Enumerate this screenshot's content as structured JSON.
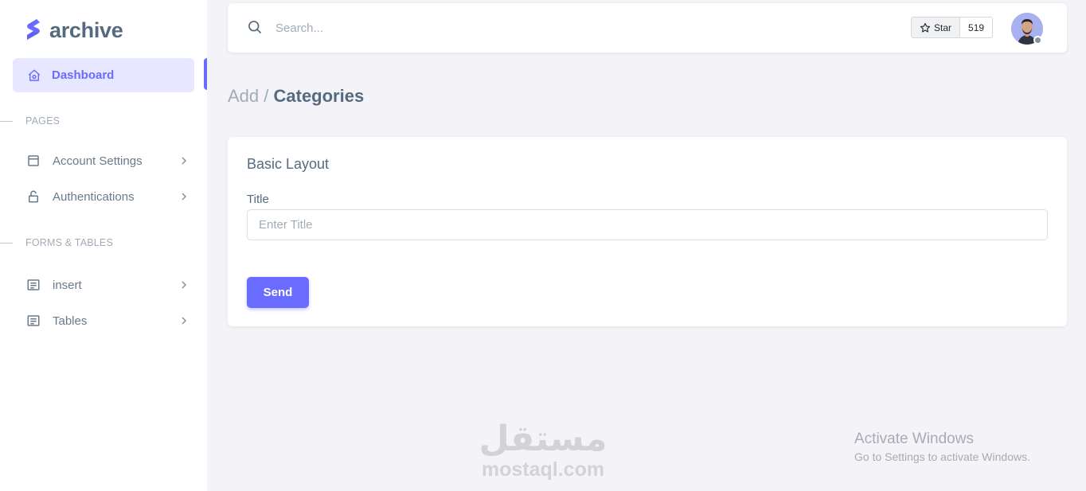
{
  "brand": {
    "name": "archive",
    "color": "#696cff"
  },
  "sidebar": {
    "active_item": {
      "label": "Dashboard",
      "icon": "home-icon"
    },
    "sections": [
      {
        "title": "PAGES",
        "items": [
          {
            "label": "Account Settings",
            "icon": "layout-icon"
          },
          {
            "label": "Authentications",
            "icon": "lock-icon"
          }
        ]
      },
      {
        "title": "FORMS & TABLES",
        "items": [
          {
            "label": "insert",
            "icon": "list-icon"
          },
          {
            "label": "Tables",
            "icon": "list-icon"
          }
        ]
      }
    ]
  },
  "topbar": {
    "search_placeholder": "Search...",
    "star_label": "Star",
    "star_count": "519"
  },
  "page": {
    "breadcrumb_parent": "Add /",
    "breadcrumb_current": "Categories"
  },
  "card": {
    "title": "Basic Layout",
    "field_label": "Title",
    "field_placeholder": "Enter Title",
    "field_value": "",
    "submit_label": "Send"
  },
  "watermarks": {
    "mostaql_arabic": "مستقل",
    "mostaql_latin": "mostaql.com",
    "activate_title": "Activate Windows",
    "activate_subtitle": "Go to Settings to activate Windows."
  }
}
